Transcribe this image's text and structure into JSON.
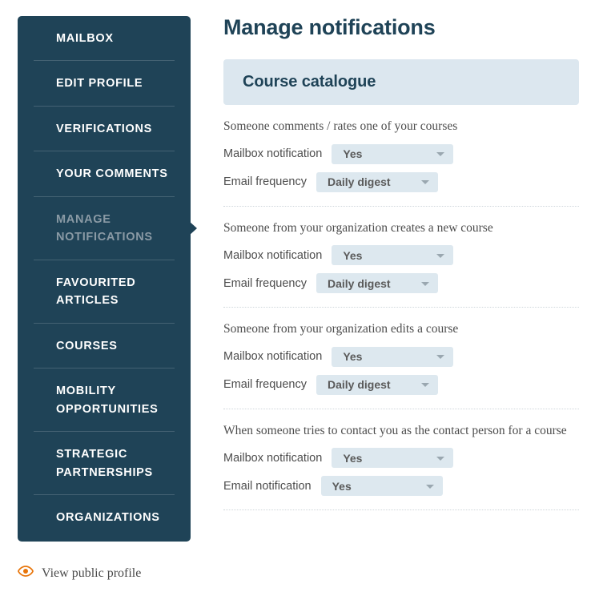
{
  "sidebar": {
    "items": [
      {
        "label": "Mailbox",
        "active": false
      },
      {
        "label": "Edit profile",
        "active": false
      },
      {
        "label": "Verifications",
        "active": false
      },
      {
        "label": "Your comments",
        "active": false
      },
      {
        "label": "Manage notifications",
        "active": true
      },
      {
        "label": "Favourited articles",
        "active": false
      },
      {
        "label": "Courses",
        "active": false
      },
      {
        "label": "Mobility opportunities",
        "active": false
      },
      {
        "label": "Strategic partnerships",
        "active": false
      },
      {
        "label": "Organizations",
        "active": false
      }
    ],
    "public_profile": {
      "label": "View public profile",
      "icon": "eye-icon",
      "icon_color": "#e8750a"
    }
  },
  "main": {
    "title": "Manage notifications",
    "section_banner": "Course catalogue",
    "groups": [
      {
        "title": "Someone comments / rates one of your courses",
        "fields": [
          {
            "label": "Mailbox notification",
            "value": "Yes",
            "width": "mailbox"
          },
          {
            "label": "Email frequency",
            "value": "Daily digest",
            "width": "freq"
          }
        ]
      },
      {
        "title": "Someone from your organization creates a new course",
        "fields": [
          {
            "label": "Mailbox notification",
            "value": "Yes",
            "width": "mailbox"
          },
          {
            "label": "Email frequency",
            "value": "Daily digest",
            "width": "freq"
          }
        ]
      },
      {
        "title": "Someone from your organization edits a course",
        "fields": [
          {
            "label": "Mailbox notification",
            "value": "Yes",
            "width": "mailbox"
          },
          {
            "label": "Email frequency",
            "value": "Daily digest",
            "width": "freq"
          }
        ]
      },
      {
        "title": "When someone tries to contact you as the contact person for a course",
        "fields": [
          {
            "label": "Mailbox notification",
            "value": "Yes",
            "width": "mailbox"
          },
          {
            "label": "Email notification",
            "value": "Yes",
            "width": "freq"
          }
        ]
      }
    ]
  },
  "colors": {
    "sidebar_bg": "#1f4357",
    "banner_bg": "#dce7ef",
    "dropdown_bg": "#dde8ef",
    "accent_orange": "#e8750a",
    "heading": "#1f4357"
  }
}
